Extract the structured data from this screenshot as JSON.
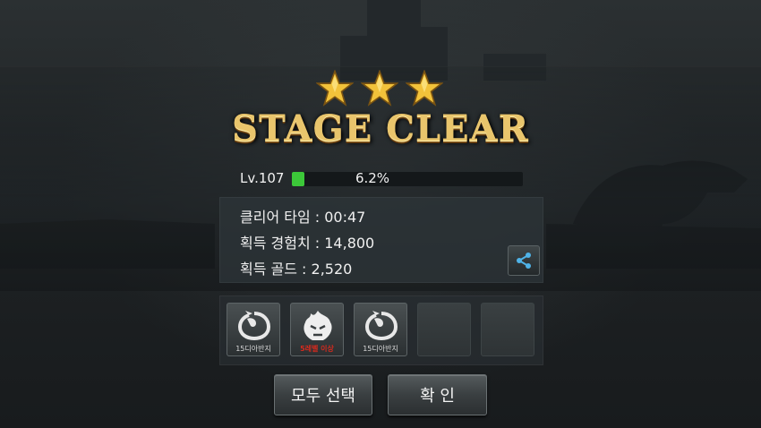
{
  "header": {
    "stars_earned": 3,
    "stars_total": 3,
    "title": "STAGE CLEAR"
  },
  "level": {
    "label": "Lv.107",
    "exp_percent_text": "6.2%",
    "exp_fraction": 0.062
  },
  "results": {
    "clear_time": "클리어 타임 : 00:47",
    "exp_gained": "획득 경험치 : 14,800",
    "gold_gained": "획득 골드 : 2,520"
  },
  "rewards": [
    {
      "icon": "dragon-ring-icon",
      "label": "15디아반지"
    },
    {
      "icon": "flame-demon-icon",
      "label": "5레벨 이상"
    },
    {
      "icon": "dragon-ring-icon",
      "label": "15디아반지"
    },
    {
      "icon": "empty-slot",
      "label": ""
    },
    {
      "icon": "empty-slot",
      "label": ""
    }
  ],
  "buttons": {
    "select_all": "모두 선택",
    "confirm": "확 인"
  },
  "colors": {
    "star_gold": "#f2c23a",
    "title_gold": "#e9c56c",
    "exp_green": "#3cc839",
    "share_blue": "#4fb3e8"
  }
}
